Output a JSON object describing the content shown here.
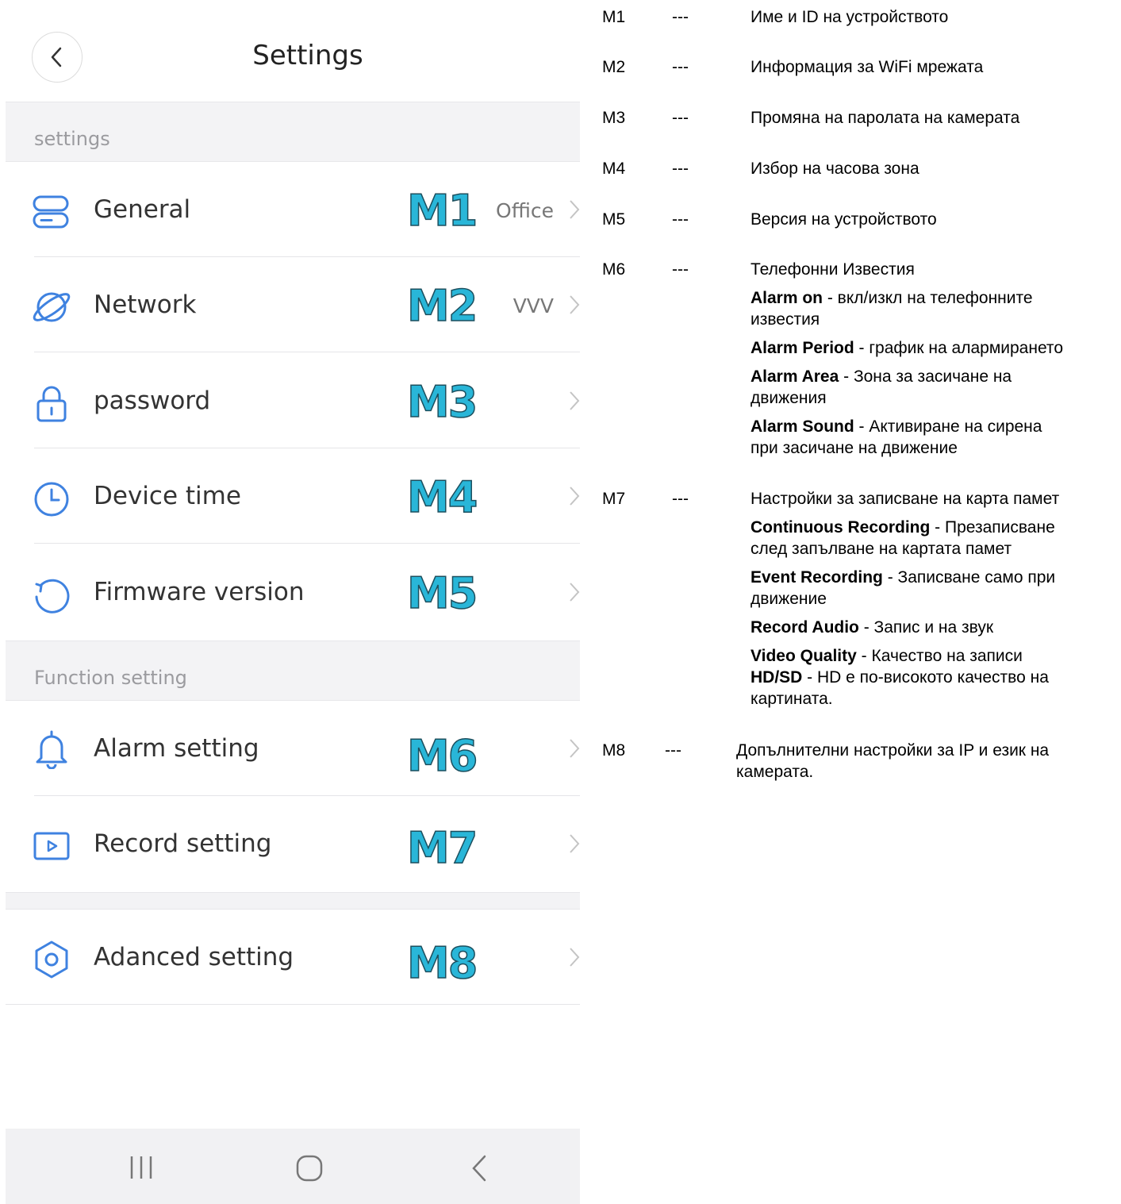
{
  "header": {
    "title": "Settings"
  },
  "sections": [
    {
      "title": "settings"
    },
    {
      "title": "Function setting"
    }
  ],
  "rows": [
    {
      "label": "General",
      "marker": "M1",
      "value": "Office",
      "icon": "device-icon"
    },
    {
      "label": "Network",
      "marker": "M2",
      "value": "VVV",
      "icon": "globe-icon"
    },
    {
      "label": "password",
      "marker": "M3",
      "value": "",
      "icon": "lock-icon"
    },
    {
      "label": "Device time",
      "marker": "M4",
      "value": "",
      "icon": "clock-icon"
    },
    {
      "label": "Firmware version",
      "marker": "M5",
      "value": "",
      "icon": "refresh-icon"
    },
    {
      "label": "Alarm setting",
      "marker": "M6",
      "value": "",
      "icon": "bell-icon"
    },
    {
      "label": "Record setting",
      "marker": "M7",
      "value": "",
      "icon": "play-icon"
    },
    {
      "label": "Adanced setting",
      "marker": "M8",
      "value": "",
      "icon": "hexagon-icon"
    }
  ],
  "colors": {
    "marker": "#29b6d8",
    "icon": "#3f82e0",
    "section_bg": "#f3f3f5"
  },
  "legend": [
    {
      "code": "M1",
      "dash": "---",
      "text": "Име и ID на устройството",
      "subs": []
    },
    {
      "code": "M2",
      "dash": "---",
      "text": "Информация за WiFi мрежата",
      "subs": []
    },
    {
      "code": "M3",
      "dash": "---",
      "text": "Промяна на паролата на камерата",
      "subs": []
    },
    {
      "code": "M4",
      "dash": "---",
      "text": "Избор на часова зона",
      "subs": []
    },
    {
      "code": "M5",
      "dash": "---",
      "text": "Версия на устройството",
      "subs": []
    },
    {
      "code": "M6",
      "dash": "---",
      "text": "Телефонни Известия",
      "subs": [
        {
          "bold": "Alarm on",
          "rest": " - вкл/изкл на телефонните",
          "rest2": "известия"
        },
        {
          "bold": "Alarm Period",
          "rest": " - график на алармирането",
          "rest2": ""
        },
        {
          "bold": "Alarm Area",
          "rest": " - Зона за засичане на",
          "rest2": "движения"
        },
        {
          "bold": "Alarm Sound",
          "rest": " - Активиране на сирена",
          "rest2": "при засичане на движение"
        }
      ]
    },
    {
      "code": "M7",
      "dash": "---",
      "text": "Настройки за записване на карта памет",
      "subs": [
        {
          "bold": "Continuous Recording",
          "rest": " - Презаписване",
          "rest2": "след запълване на картата памет"
        },
        {
          "bold": "Event Recording",
          "rest": " - Записване само при",
          "rest2": "движение"
        },
        {
          "bold": "Record Audio",
          "rest": " - Запис и на звук",
          "rest2": ""
        },
        {
          "bold": "Video Quality",
          "rest": " - Качество на записи",
          "rest2": ""
        },
        {
          "bold": "HD/SD",
          "rest": " - HD е по-високото качество на",
          "rest2": "картината."
        }
      ]
    },
    {
      "code": "M8",
      "dash": "---",
      "text": "Допълнителни настройки за IP и език на",
      "text2": "камерата.",
      "subs": []
    }
  ]
}
